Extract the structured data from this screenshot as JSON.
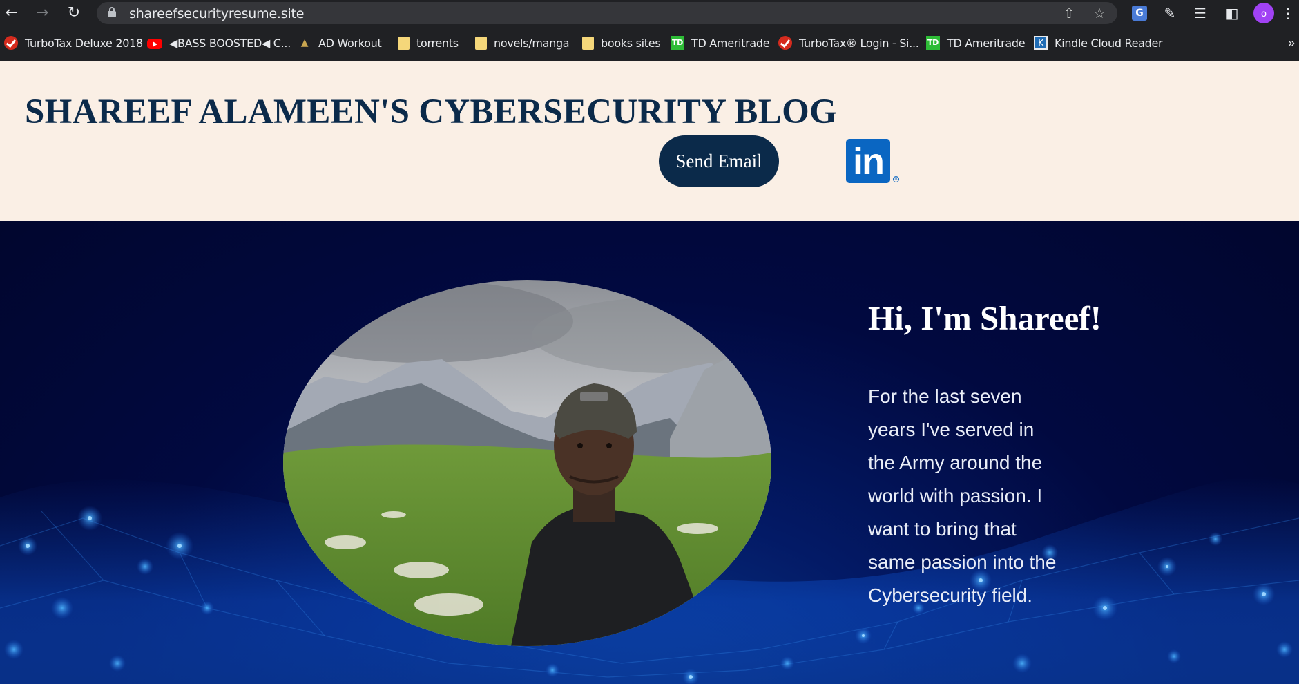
{
  "browser": {
    "url": "shareefsecurityresume.site",
    "avatar_initial": "o",
    "icons": [
      "back-arrow-icon",
      "forward-arrow-icon",
      "reload-icon",
      "lock-icon",
      "share-icon",
      "star-icon",
      "translate-icon",
      "extensions-icon",
      "reading-list-icon",
      "side-panel-icon",
      "kebab-menu-icon"
    ],
    "bookmarks": [
      {
        "label": "TurboTax Deluxe 2018",
        "icon": "turbotax-icon"
      },
      {
        "label": "◀BASS BOOSTED◀ C...",
        "icon": "youtube-icon"
      },
      {
        "label": "AD Workout",
        "icon": "ad-workout-icon"
      },
      {
        "label": "torrents",
        "icon": "folder-icon"
      },
      {
        "label": "novels/manga",
        "icon": "folder-icon"
      },
      {
        "label": "books sites",
        "icon": "folder-icon"
      },
      {
        "label": "TD Ameritrade",
        "icon": "td-icon"
      },
      {
        "label": "TurboTax® Login - Si...",
        "icon": "turbotax-icon"
      },
      {
        "label": "TD Ameritrade",
        "icon": "td-icon"
      },
      {
        "label": "Kindle Cloud Reader",
        "icon": "kindle-icon"
      }
    ],
    "more_label": "»"
  },
  "header": {
    "title": "SHAREEF ALAMEEN'S CYBERSECURITY BLOG",
    "send_email_label": "Send Email",
    "linkedin_label": "in",
    "registered_mark": "R"
  },
  "hero": {
    "heading": "Hi, I'm Shareef!",
    "lines": [
      "For the last seven",
      "years I've served in",
      "the Army around the",
      "world with passion. I",
      "want to bring that",
      "same passion into the",
      "Cybersecurity field."
    ]
  },
  "colors": {
    "header_bg": "#faefe5",
    "title_navy": "#0b2a4a",
    "hero_bg": "#010940",
    "linkedin_blue": "#0a66c2"
  }
}
